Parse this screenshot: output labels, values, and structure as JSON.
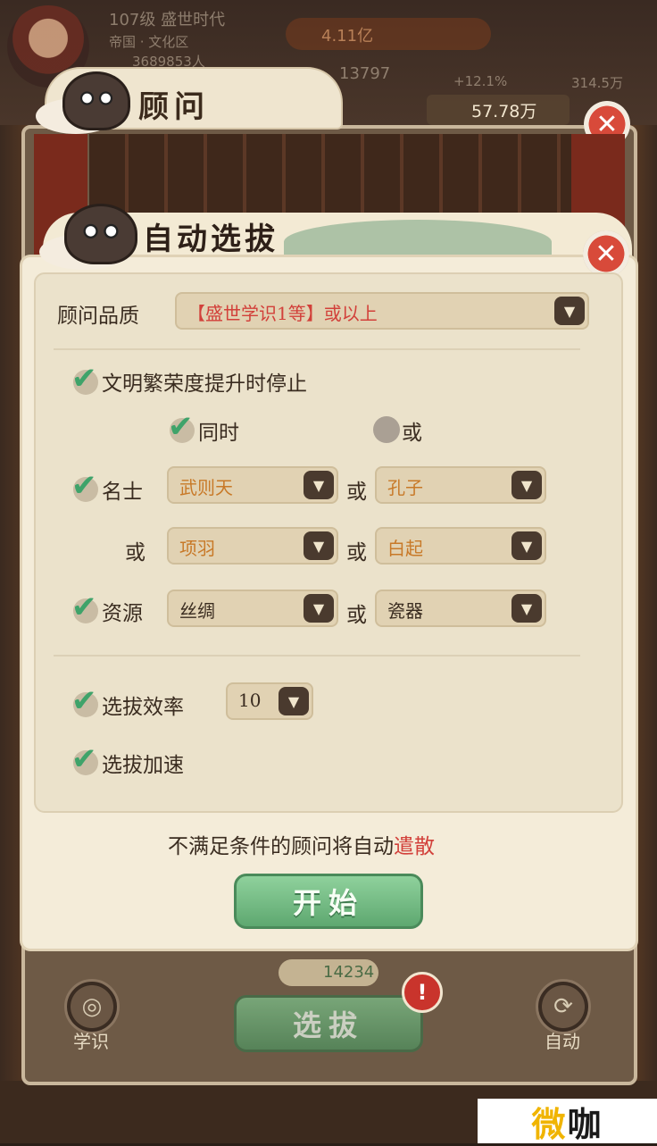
{
  "background": {
    "player_level_name": "107级 盛世时代",
    "player_subtitle": "帝国 · 文化区",
    "population": "3689853人",
    "coins": "4.11亿",
    "stat_a": "13797",
    "stat_b": "+12.1%",
    "stat_c": "314.5万"
  },
  "advisor_panel": {
    "title": "顾问",
    "money": "57.78万",
    "close_icon": "close-icon"
  },
  "dialog": {
    "title": "自动选拔",
    "quality_label": "顾问品质",
    "quality_value": "【盛世学识1等】或以上",
    "stop_on_prosperity_label": "文明繁荣度提升时停止",
    "logic_and_label": "同时",
    "logic_or_label": "或",
    "celebrity_label": "名士",
    "or": "或",
    "celebrity_1": "武则天",
    "celebrity_2": "孔子",
    "celebrity_3": "项羽",
    "celebrity_4": "白起",
    "resource_label": "资源",
    "resource_1": "丝绸",
    "resource_2": "瓷器",
    "efficiency_label": "选拔效率",
    "efficiency_value": "10",
    "speedup_label": "选拔加速",
    "note_prefix": "不满足条件的顾问将自动",
    "note_action": "遣散",
    "start_button": "开始"
  },
  "bottom_bar": {
    "scroll_count": "14234",
    "select_button": "选拔",
    "badge": "!",
    "left_button": "学识",
    "right_button": "自动"
  },
  "watermark": {
    "text_accent": "微",
    "text_rest": "咖"
  },
  "colors": {
    "accent_green": "#3fa36a",
    "warning_red": "#d2403a",
    "value_orange": "#c87928"
  }
}
